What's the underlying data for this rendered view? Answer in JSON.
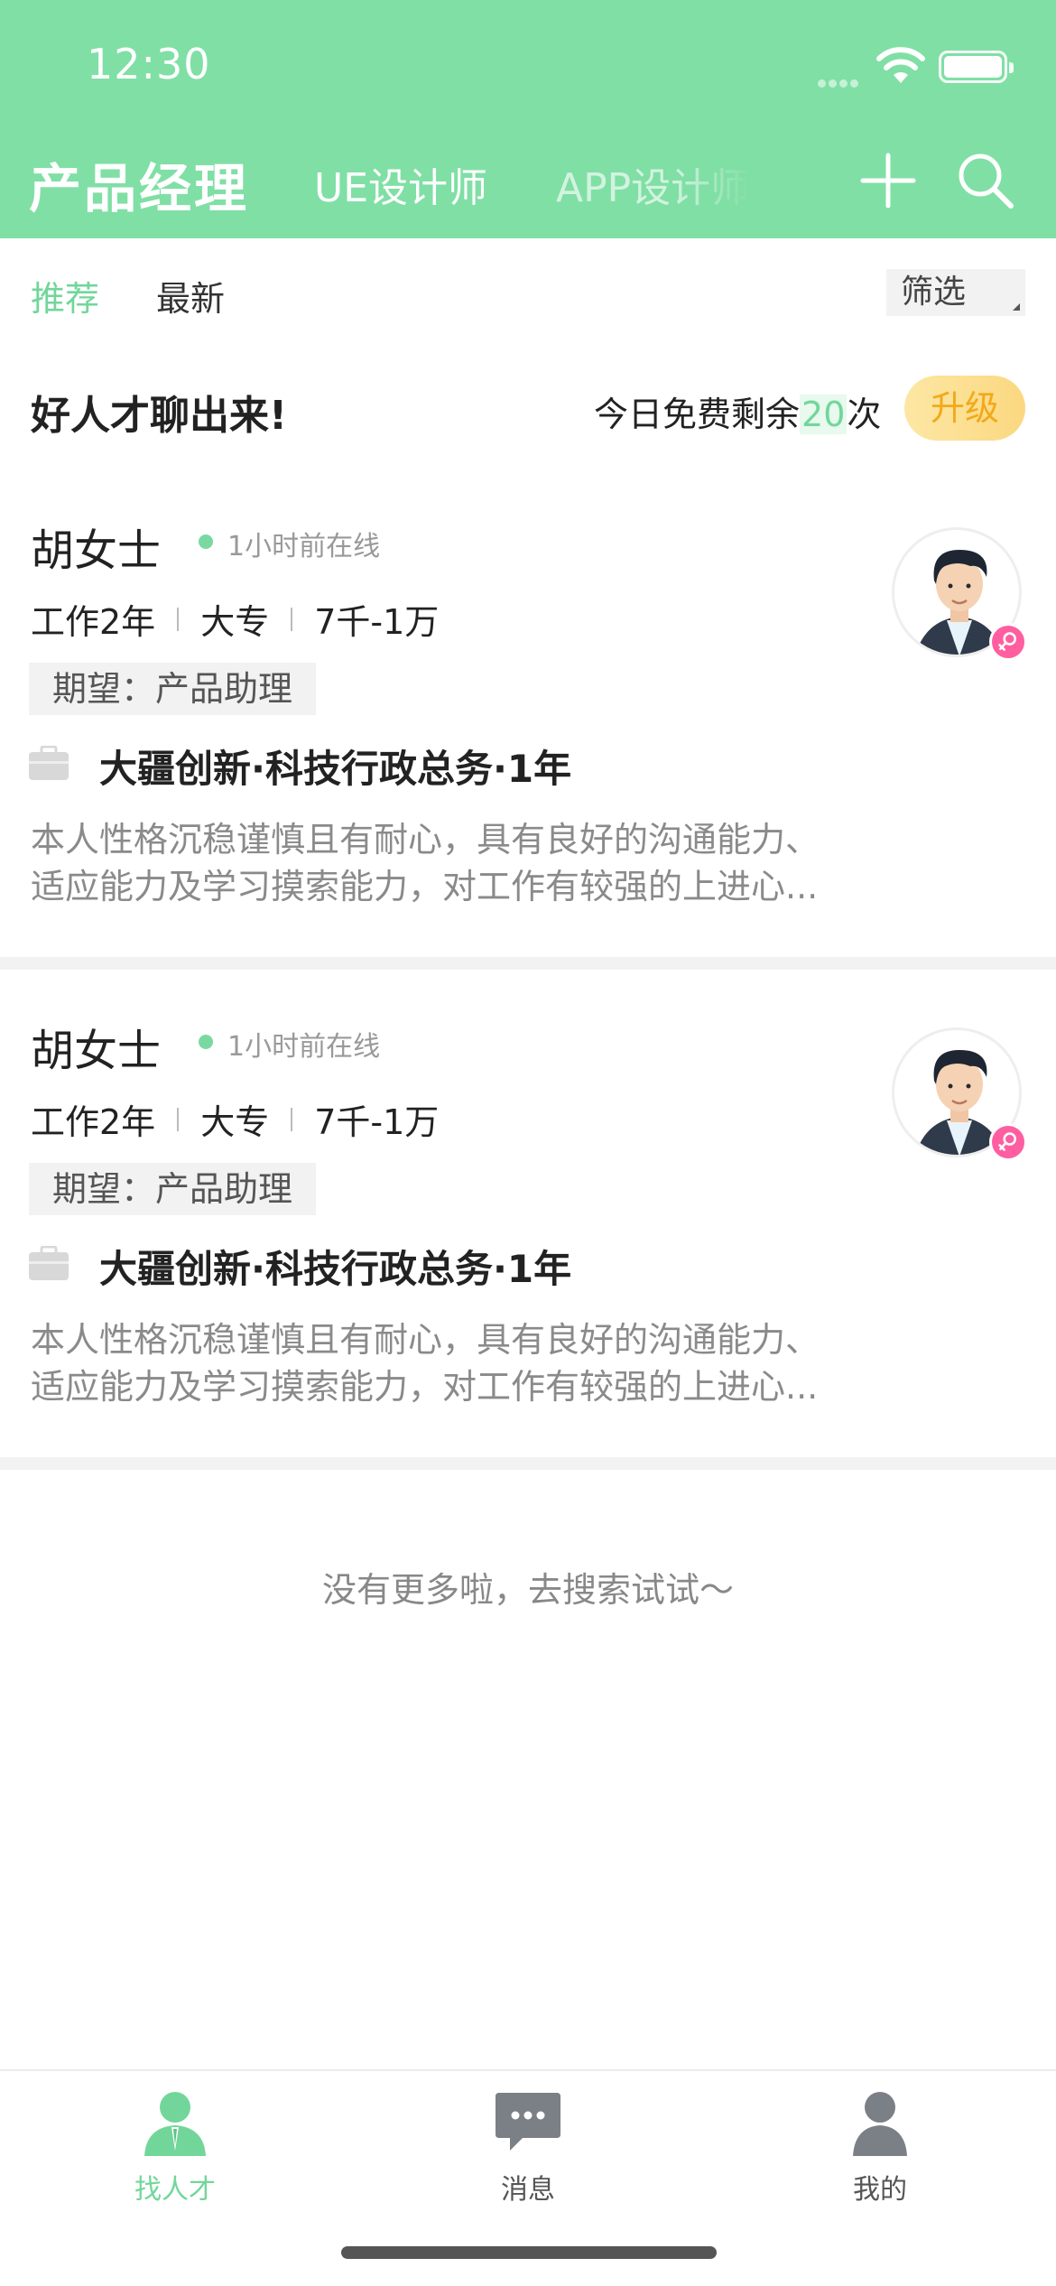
{
  "status_bar": {
    "time": "12:30"
  },
  "header": {
    "job_tabs": [
      "产品经理",
      "UE设计师",
      "APP设计师"
    ],
    "icons": [
      "plus-icon",
      "search-icon"
    ]
  },
  "sub_tabs": {
    "recommended": "推荐",
    "latest": "最新",
    "filter": "筛选"
  },
  "promo": {
    "title": "好人才聊出来!",
    "quota_prefix": "今日免费剩余",
    "quota_num": "20",
    "quota_suffix": "次",
    "upgrade": "升级"
  },
  "candidates": [
    {
      "name": "胡女士",
      "online": "1小时前在线",
      "experience": "工作2年",
      "education": "大专",
      "salary": "7千-1万",
      "expect": "期望：产品助理",
      "work_title": "大疆创新·科技行政总务·1年",
      "desc_line1": "本人性格沉稳谨慎且有耐心，具有良好的沟通能力、",
      "desc_line2": "适应能力及学习摸索能力，对工作有较强的上进心..."
    },
    {
      "name": "胡女士",
      "online": "1小时前在线",
      "experience": "工作2年",
      "education": "大专",
      "salary": "7千-1万",
      "expect": "期望：产品助理",
      "work_title": "大疆创新·科技行政总务·1年",
      "desc_line1": "本人性格沉稳谨慎且有耐心，具有良好的沟通能力、",
      "desc_line2": "适应能力及学习摸索能力，对工作有较强的上进心..."
    }
  ],
  "footer_hint": "没有更多啦，去搜索试试～",
  "tabbar": [
    {
      "label": "找人才",
      "icon": "person-icon",
      "active": true
    },
    {
      "label": "消息",
      "icon": "chat-bubble-icon",
      "active": false
    },
    {
      "label": "我的",
      "icon": "user-icon",
      "active": false
    }
  ],
  "colors": {
    "primary": "#80dfa5",
    "accent": "#72d69a",
    "upgrade": "#f2a91a",
    "female": "#ff5ea0"
  }
}
